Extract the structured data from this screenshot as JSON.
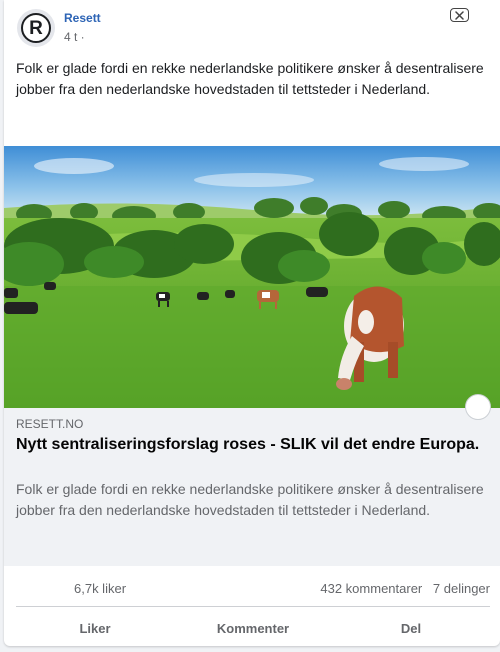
{
  "post": {
    "page_name": "Resett",
    "avatar_letter": "R",
    "time": "4 t ·",
    "text": "Folk er glade fordi en rekke nederlandske politikere ønsker å desentralisere jobber fra den nederlandske hovedstaden til tettsteder i Nederland.",
    "close_icon": "close-icon"
  },
  "link": {
    "image": "illustration-cows-grazing-meadow",
    "domain": "RESETT.NO",
    "title": "Nytt sentraliseringsforslag roses - SLIK vil det endre Europa.",
    "description": "Folk er glade fordi en rekke nederlandske politikere ønsker å desentralisere jobber fra den nederlandske hovedstaden til tettsteder i Nederland."
  },
  "stats": {
    "likes": "6,7k liker",
    "comments": "432 kommentarer",
    "shares": "7 delinger"
  },
  "actions": {
    "like": "Liker",
    "comment": "Kommenter",
    "share": "Del"
  }
}
